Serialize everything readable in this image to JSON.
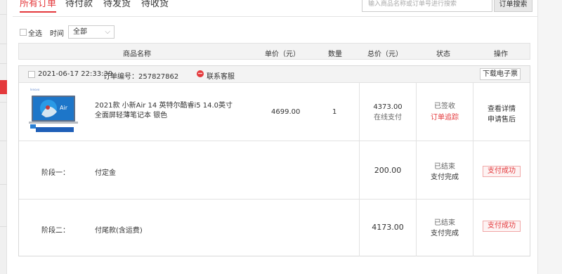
{
  "tabs": [
    "所有订单",
    "待付款",
    "待发货",
    "待收货"
  ],
  "search": {
    "placeholder": "输入商品名称或订单号进行搜索",
    "button": "订单搜索"
  },
  "filter": {
    "select_all": "全选",
    "time_label": "时间",
    "time_value": "全部"
  },
  "table_header": {
    "name": "商品名称",
    "unit_price": "单价（元）",
    "quantity": "数量",
    "total": "总价（元）",
    "status": "状态",
    "actions": "操作"
  },
  "order": {
    "date": "2021-06-17 22:33:39",
    "order_no": "订单编号：257827862",
    "customer_service": "联系客服",
    "invoice_button": "下载电子票",
    "product": {
      "name": "2021款 小新Air 14 英特尔酷睿i5 14.0英寸全面屏轻薄笔记本 银色",
      "unit_price": "4699.00",
      "quantity": "1",
      "total": "4373.00",
      "payment": "在线支付",
      "status": "已签收",
      "tracking": "订单追踪",
      "actions": [
        "查看详情",
        "申请售后"
      ]
    },
    "stages": [
      {
        "label": "阶段一：",
        "item": "付定金",
        "amount": "200.00",
        "status": "已结束",
        "status2": "支付完成",
        "badge": "支付成功"
      },
      {
        "label": "阶段二：",
        "item": "付尾款(含运费)",
        "amount": "4173.00",
        "status": "已结束",
        "status2": "支付完成",
        "badge": "支付成功"
      }
    ]
  },
  "colors": {
    "accent": "#e4393c",
    "header_bg": "#f3f3f3",
    "border": "#e2e2e2"
  }
}
